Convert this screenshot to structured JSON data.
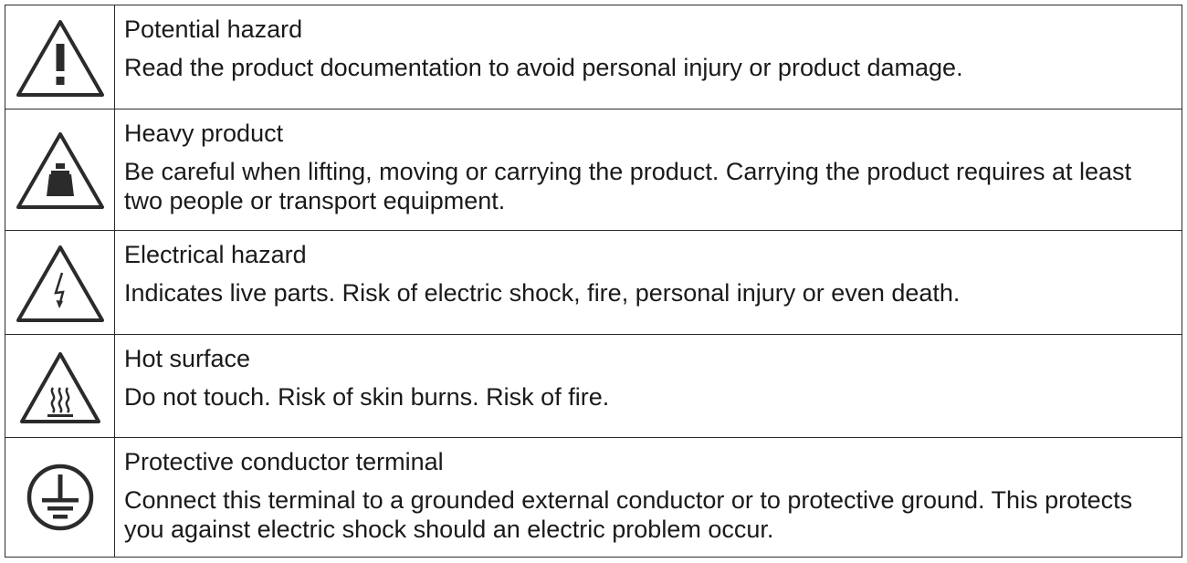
{
  "rows": [
    {
      "icon": "warning-exclamation-icon",
      "title": "Potential hazard",
      "description": "Read the product documentation to avoid personal injury or product damage."
    },
    {
      "icon": "heavy-weight-icon",
      "title": "Heavy product",
      "description": "Be careful when lifting, moving or carrying the product. Carrying the product requires at least two people or transport equipment."
    },
    {
      "icon": "electrical-hazard-icon",
      "title": "Electrical hazard",
      "description": "Indicates live parts. Risk of electric shock, fire, personal injury or even death."
    },
    {
      "icon": "hot-surface-icon",
      "title": "Hot surface",
      "description": "Do not touch. Risk of skin burns. Risk of fire."
    },
    {
      "icon": "protective-ground-icon",
      "title": "Protective conductor terminal",
      "description": "Connect this terminal to a grounded external conductor or to protective ground. This protects you against electric shock should an electric problem occur."
    }
  ],
  "colors": {
    "line": "#2b2b2b",
    "text": "#1a1a1a"
  }
}
